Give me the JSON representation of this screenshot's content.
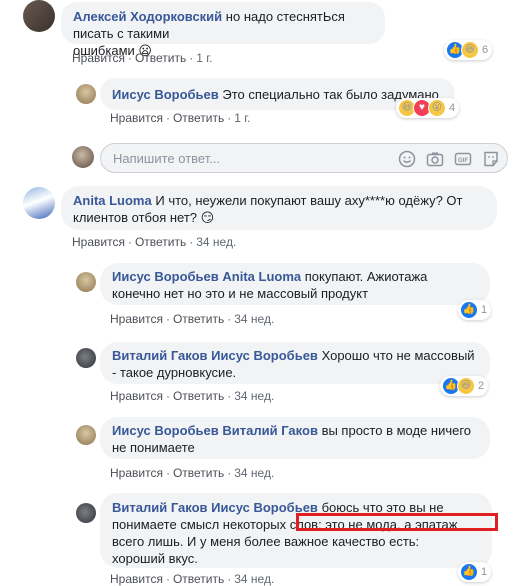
{
  "comments": [
    {
      "author": "Алексей Ходорковский",
      "text1": "но надо стеснятЬся писать с такими",
      "text2": "ошибками 😦",
      "like": "Нравится",
      "reply": "Ответить",
      "time": "1 г.",
      "reaction_count": "6"
    },
    {
      "author": "Иисус Воробьев",
      "text": "Это специально так было задумано",
      "like": "Нравится",
      "reply": "Ответить",
      "time": "1 г.",
      "reaction_count": "4"
    },
    {
      "author": "Anita Luoma",
      "text1": "И что, неужели покупают вашу аху****ю одёжу? От",
      "text2": "клиентов отбоя нет? 😏",
      "like": "Нравится",
      "reply": "Ответить",
      "time": "34 нед."
    },
    {
      "author": "Иисус Воробьев",
      "mention": "Anita Luoma",
      "text1": "покупают. Ажиотажа",
      "text2": "конечно нет но это и не массовый продукт",
      "like": "Нравится",
      "reply": "Ответить",
      "time": "34 нед.",
      "reaction_count": "1"
    },
    {
      "author": "Виталий Гаков",
      "mention": "Иисус Воробьев",
      "text1": "Хорошо что не массовый",
      "text2": "- такое дурновкусие.",
      "like": "Нравится",
      "reply": "Ответить",
      "time": "34 нед.",
      "reaction_count": "2"
    },
    {
      "author": "Иисус Воробьев",
      "mention": "Виталий Гаков",
      "text1": "вы просто в моде ничего",
      "text2": "не понимаете",
      "like": "Нравится",
      "reply": "Ответить",
      "time": "34 нед."
    },
    {
      "author": "Виталий Гаков",
      "mention": "Иисус Воробьев",
      "text1": "боюсь что это вы не",
      "text2": "понимаете смысл некоторых слов: это не мода, а эпатаж",
      "text3": "всего лишь. И у меня более важное качество есть:",
      "text4": "хороший вкус.",
      "like": "Нравится",
      "reply": "Ответить",
      "time": "34 нед.",
      "reaction_count": "1"
    }
  ],
  "reply_input": {
    "placeholder": "Напишите ответ..."
  },
  "icons": [
    "emoji-icon",
    "camera-icon",
    "gif-icon",
    "sticker-icon"
  ],
  "colors": {
    "author": "#385898",
    "bubble": "#f2f3f5",
    "highlight": "#e02020",
    "like": "#1877f2"
  }
}
